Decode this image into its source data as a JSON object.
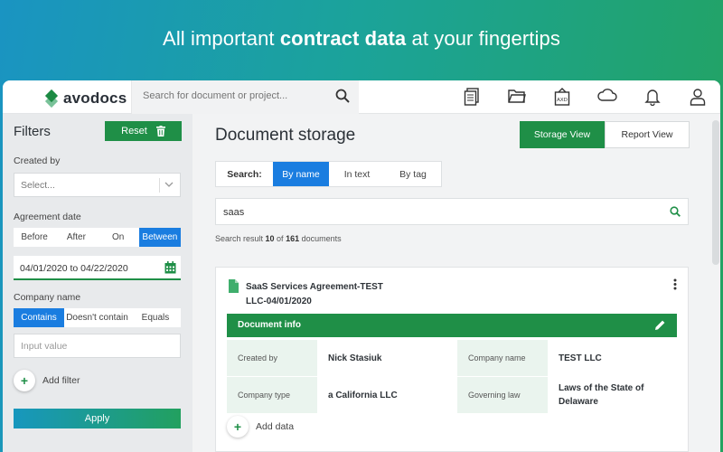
{
  "hero": {
    "prefix": "All important ",
    "bold": "contract data",
    "suffix": " at your fingertips"
  },
  "colors": {
    "brand_green": "#1f8f47",
    "active_blue": "#1a7de0",
    "info_key_bg": "#eaf4ee"
  },
  "topbar": {
    "logo_text": "avodocs",
    "search_placeholder": "Search for document or project...",
    "icons": [
      "documents-icon",
      "folder-icon",
      "building-icon",
      "cloud-icon",
      "bell-icon",
      "user-icon"
    ]
  },
  "sidebar": {
    "title": "Filters",
    "reset_label": "Reset",
    "created_by_label": "Created by",
    "created_by_placeholder": "Select...",
    "agreement_date_label": "Agreement date",
    "date_modes": [
      "Before",
      "After",
      "On",
      "Between"
    ],
    "date_mode_selected": "Between",
    "date_range": "04/01/2020 to 04/22/2020",
    "company_name_label": "Company name",
    "company_modes": [
      "Contains",
      "Doesn't contain",
      "Equals"
    ],
    "company_mode_selected": "Contains",
    "input_placeholder": "Input value",
    "add_filter_label": "Add filter",
    "apply_label": "Apply"
  },
  "main": {
    "title": "Document storage",
    "view_toggle": [
      "Storage View",
      "Report View"
    ],
    "view_selected": "Storage View",
    "search_label": "Search:",
    "search_tabs": [
      "By name",
      "In text",
      "By tag"
    ],
    "search_tab_selected": "By name",
    "query": "saas",
    "result": {
      "prefix": "Search result ",
      "count": "10",
      "middle": " of ",
      "total": "161",
      "suffix": " documents"
    },
    "document": {
      "title": "SaaS Services Agreement-TEST LLC-04/01/2020",
      "info_header": "Document info",
      "fields": [
        {
          "key": "Created by",
          "value": "Nick Stasiuk",
          "key2": "Company name",
          "value2": "TEST LLC"
        },
        {
          "key": "Company type",
          "value": "a California LLC",
          "key2": "Governing law",
          "value2": "Laws of the State of Delaware"
        }
      ],
      "add_data_label": "Add data"
    }
  }
}
